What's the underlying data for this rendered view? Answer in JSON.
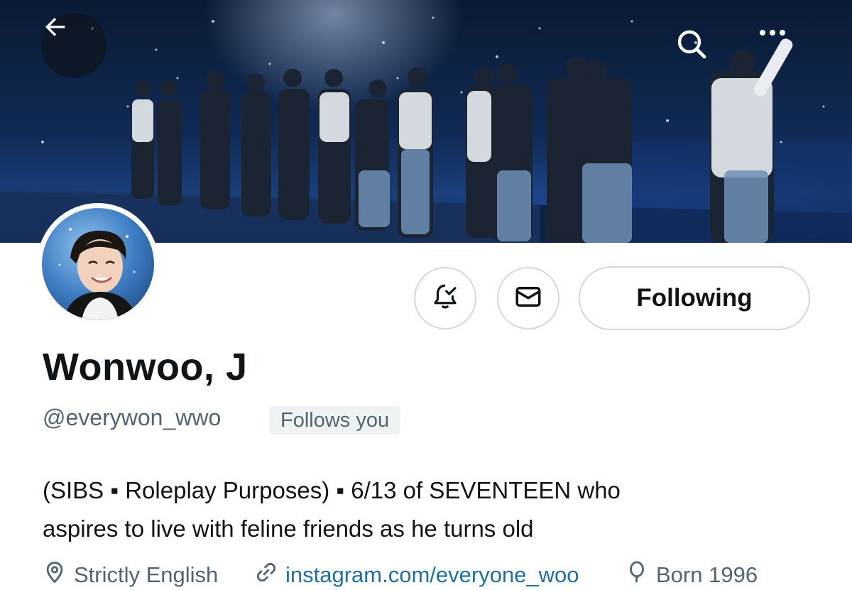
{
  "header": {
    "back_icon": "arrow-left-icon",
    "search_icon": "search-icon",
    "more_icon": "more-horizontal-icon"
  },
  "profile": {
    "display_name": "Wonwoo, J",
    "handle": "@everywon_wwo",
    "follows_you_badge": "Follows you",
    "bio_line1": "(SIBS ▪ Roleplay Purposes) ▪ 6/13 of SEVENTEEN who",
    "bio_line2": "aspires to live with feline friends as he turns old"
  },
  "actions": {
    "notify_icon": "bell-check-icon",
    "message_icon": "envelope-icon",
    "following_label": "Following"
  },
  "meta": {
    "location": "Strictly English",
    "link": "instagram.com/everyone_woo",
    "born": "Born 1996"
  },
  "colors": {
    "text": "#0f1419",
    "secondary_text": "#536471",
    "link": "#1d6fa5",
    "border": "#cfd9de",
    "badge_bg": "#eff3f4"
  }
}
